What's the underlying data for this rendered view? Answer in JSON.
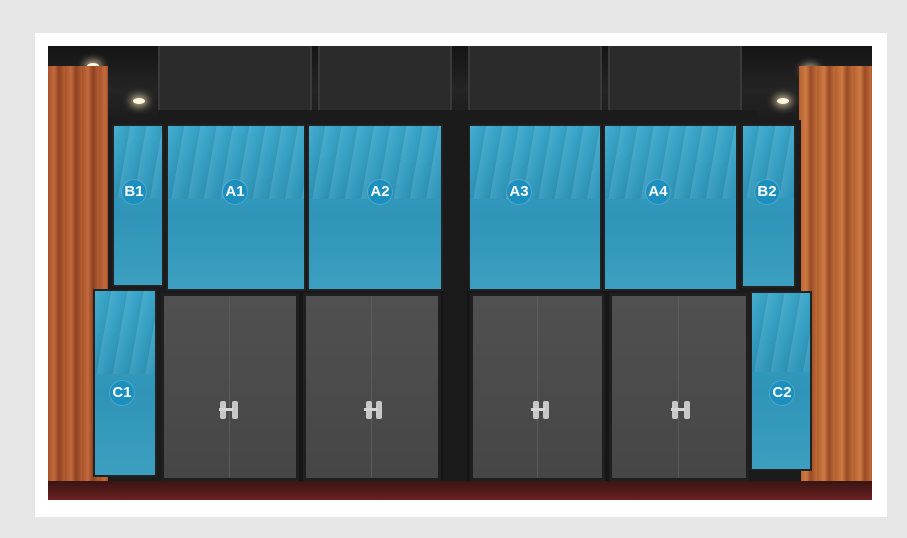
{
  "labels": {
    "a1": "A1",
    "a2": "A2",
    "a3": "A3",
    "a4": "A4",
    "b1": "B1",
    "b2": "B2",
    "c1": "C1",
    "c2": "C2"
  },
  "colors": {
    "badge": "#1a8fc0",
    "tinted_glass": "#3aa6c9",
    "wood_wall": "#b35f33",
    "door_panel": "#4a4a4a",
    "background": "#e6e6e6"
  }
}
